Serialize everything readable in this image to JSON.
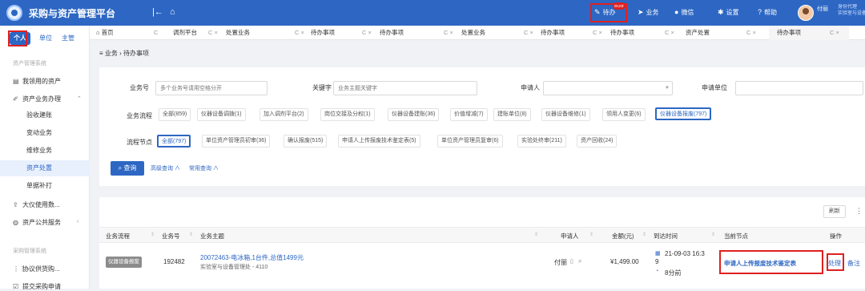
{
  "header": {
    "app_title": "采购与资产管理平台",
    "collapse_icon": "|←",
    "home_icon": "⌂",
    "todo_label": "待办",
    "todo_count": "859",
    "nav": [
      {
        "label": "业务",
        "icon": "send-icon"
      },
      {
        "label": "微信",
        "icon": "wechat-icon"
      },
      {
        "label": "设置",
        "icon": "gear-icon"
      },
      {
        "label": "帮助",
        "icon": "help-icon"
      }
    ],
    "user_name": "付丽",
    "user_role_line1": "身份代理",
    "user_role_line2": "实验室与设备管理"
  },
  "sidebar": {
    "toggles": [
      "个人",
      "单位",
      "主管"
    ],
    "sections": [
      "资产管理系统",
      "采购管理系统"
    ],
    "items": {
      "my_assets": "我领用的资产",
      "asset_business": "资产业务办理",
      "acceptance": "验收建账",
      "change": "变动业务",
      "maintenance": "维修业务",
      "disposal": "资产处置",
      "reprint": "单据补打",
      "instrument_use": "大仪使用数...",
      "public_service": "资产公共服务",
      "supply_contract": "协议供货购...",
      "purchase_request": "提交采购申请"
    }
  },
  "tabs": [
    {
      "label": "首页"
    },
    {
      "label": "调剂平台"
    },
    {
      "label": "处置业务"
    },
    {
      "label": "待办事项"
    },
    {
      "label": "待办事项"
    },
    {
      "label": "处置业务"
    },
    {
      "label": "待办事项"
    },
    {
      "label": "待办事项"
    },
    {
      "label": "资产处置"
    },
    {
      "label": "待办事项"
    }
  ],
  "breadcrumb": "≡ 业务 › 待办事项",
  "filters": {
    "business_no_label": "业务号",
    "business_no_placeholder": "多个业务号请用空格分开",
    "keyword_label": "关键字",
    "keyword_placeholder": "业务主题关键字",
    "applicant_label": "申请人",
    "unit_label": "申请单位",
    "flow_label": "业务流程",
    "flow_chips": [
      "全部(859)",
      "仪器设备调拨(1)",
      "加入调剂平台(2)",
      "岗位交接及分权(1)",
      "仪器设备建账(36)",
      "价值增减(7)",
      "建账单位(8)",
      "仪器设备维修(1)",
      "领用人变更(6)",
      "仪器设备报废(797)"
    ],
    "node_label": "流程节点",
    "node_chips": [
      "全部(797)",
      "单位资产管理员初审(36)",
      "确认报废(515)",
      "申请人上传报废技术鉴定表(5)",
      "单位资产管理员复审(6)",
      "实验处终审(211)",
      "资产回收(24)"
    ],
    "query_button": "查询",
    "advanced_query": "高级查询 ∧",
    "common_query": "常用查询 ∧"
  },
  "table": {
    "refresh_label": "刷新",
    "columns": [
      "业务流程",
      "业务号",
      "业务主题",
      "申请人",
      "金额(元)",
      "到达时间",
      "当前节点",
      "操作"
    ],
    "rows": [
      {
        "flow_tag": "仪器设备报废",
        "business_no": "192482",
        "subject": "20072463-电冰箱,1台件,总值1499元",
        "subject_sub": "实验室与设备管理处 - 4110",
        "applicant": "付丽",
        "amount": "¥1,499.00",
        "arrival_time_line1": "21-09-03 16:3",
        "arrival_time_line2": "9",
        "elapsed": "8分前",
        "current_node": "申请人上传报废技术鉴定表",
        "action_process": "处理",
        "action_note": "备注"
      }
    ]
  },
  "colors": {
    "primary": "#2d67c3",
    "highlight_box": "#e02020",
    "active_bg": "#e8f0fd"
  }
}
